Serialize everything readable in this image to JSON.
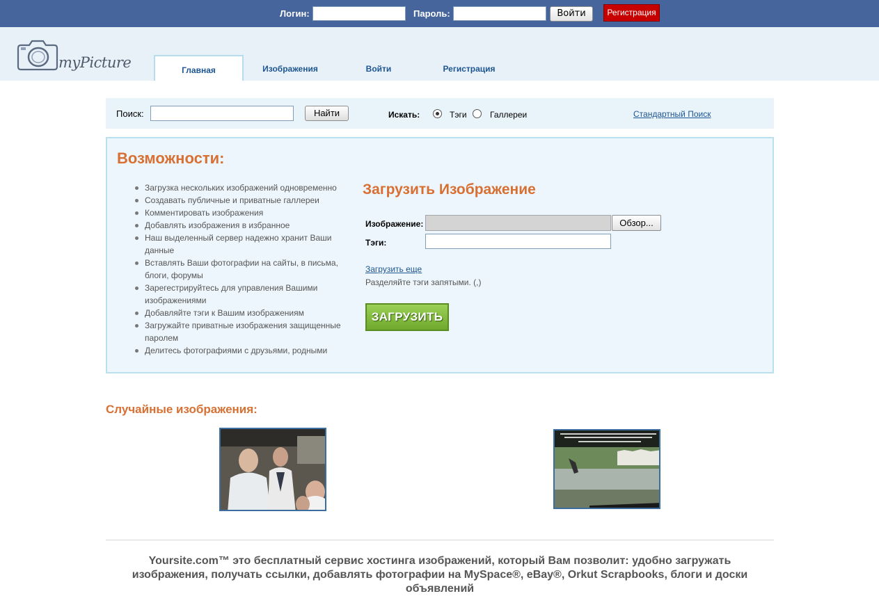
{
  "topbar": {
    "login_label": "Логин:",
    "password_label": "Пароль:",
    "login_button": "Войти",
    "register_button": "Регистрация"
  },
  "logo": {
    "text": "myPicture"
  },
  "nav": {
    "tabs": [
      {
        "label": "Главная",
        "active": true
      },
      {
        "label": "Изображения",
        "active": false
      },
      {
        "label": "Войти",
        "active": false
      },
      {
        "label": "Регистрация",
        "active": false
      }
    ]
  },
  "search": {
    "label": "Поиск:",
    "button": "Найти",
    "where_label": "Искать:",
    "options": [
      {
        "label": "Тэги",
        "checked": true
      },
      {
        "label": "Галлереи",
        "checked": false
      }
    ],
    "standard_link": "Стандартный Поиск"
  },
  "features": {
    "title": "Возможности:",
    "items": [
      "Загрузка нескольких изображений одновременно",
      "Создавать публичные и приватные галлереи",
      "Комментировать изображения",
      "Добавлять изображения в избранное",
      "Наш выделенный сервер надежно хранит Ваши данные",
      "Вставлять Ваши фотографии на сайты, в письма, блоги, форумы",
      "Зарегестрируйтесь для управления Вашими изображениями",
      "Добавляйте тэги к Вашим изображениям",
      "Загружайте приватные изображения защищенные паролем",
      "Делитесь фотографиями с друзьями, родными"
    ]
  },
  "upload": {
    "title": "Загрузить Изображение",
    "image_label": "Изображение:",
    "browse_button": "Обзор...",
    "tags_label": "Тэги:",
    "more_link": "Загрузить еще",
    "hint": "Разделяйте тэги запятыми. (,)",
    "submit_button": "ЗАГРУЗИТЬ"
  },
  "random": {
    "title": "Случайные изображения:"
  },
  "footer": {
    "text": "Yoursite.com™ это бесплатный сервис хостинга изображений, который Вам позволит: удобно загружать изображения, получать ссылки, добавлять фотографии на MySpace®, eBay®, Orkut Scrapbooks, блоги и доски объявлений"
  },
  "colors": {
    "topbar": "#46659d",
    "accent_orange": "#d77032",
    "register_red": "#c70000",
    "upload_green": "#7cb83a",
    "link_blue": "#1d5590"
  }
}
